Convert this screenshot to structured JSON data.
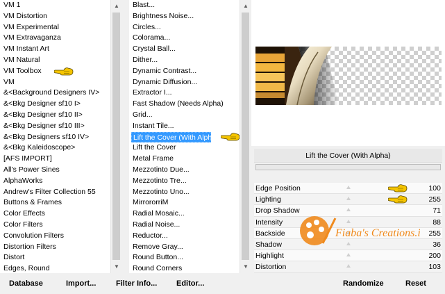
{
  "left_list": {
    "items": [
      "VM 1",
      "VM Distortion",
      "VM Experimental",
      "VM Extravaganza",
      "VM Instant Art",
      "VM Natural",
      "VM Toolbox",
      "VM",
      "&<Background Designers IV>",
      "&<Bkg Designer sf10 I>",
      "&<Bkg Designer sf10 II>",
      "&<Bkg Designer sf10 III>",
      "&<Bkg Designers sf10 IV>",
      "&<Bkg Kaleidoscope>",
      "[AFS IMPORT]",
      "All's Power Sines",
      "AlphaWorks",
      "Andrew's Filter Collection 55",
      "Buttons & Frames",
      "Color Effects",
      "Color Filters",
      "Convolution Filters",
      "Distortion Filters",
      "Distort",
      "Edges, Round"
    ],
    "highlighted_index": 6
  },
  "mid_list": {
    "items": [
      "Blast...",
      "Brightness Noise...",
      "Circles...",
      "Colorama...",
      "Crystal Ball...",
      "Dither...",
      "Dynamic Contrast...",
      "Dynamic Diffusion...",
      "Extractor I...",
      "Fast Shadow (Needs Alpha)",
      "Grid...",
      "Instant Tile...",
      "Lift the Cover (With Alpha)",
      "Lift the Cover",
      "Metal Frame",
      "Mezzotinto Due...",
      "Mezzotinto Tre...",
      "Mezzotinto Uno...",
      "MirrororriM",
      "Radial Mosaic...",
      "Radial Noise...",
      "Reductor...",
      "Remove Gray...",
      "Round Button...",
      "Round Corners"
    ],
    "selected_index": 12
  },
  "filter_title": "Lift the Cover (With Alpha)",
  "sliders": [
    {
      "label": "Edge Position",
      "value": "100",
      "hand": true
    },
    {
      "label": "Lighting",
      "value": "255",
      "hand": true
    },
    {
      "label": "Drop Shadow",
      "value": "71",
      "hand": false
    },
    {
      "label": "Intensity",
      "value": "88",
      "hand": false
    },
    {
      "label": "Backside",
      "value": "255",
      "hand": false
    },
    {
      "label": "Shadow",
      "value": "36",
      "hand": false
    },
    {
      "label": "Highlight",
      "value": "200",
      "hand": false
    },
    {
      "label": "Distortion",
      "value": "103",
      "hand": false
    }
  ],
  "buttons": {
    "database": "Database",
    "import": "Import...",
    "filter_info": "Filter Info...",
    "editor": "Editor...",
    "randomize": "Randomize",
    "reset": "Reset"
  },
  "watermark_text": "Fiaba's Creations.it",
  "icons": {
    "hand": "pointing-hand-icon",
    "scroll_up": "chevron-up-icon",
    "scroll_down": "chevron-down-icon"
  },
  "colors": {
    "selection": "#3399ff",
    "hand_yellow": "#f5c400",
    "watermark_orange": "#f08a1c"
  }
}
